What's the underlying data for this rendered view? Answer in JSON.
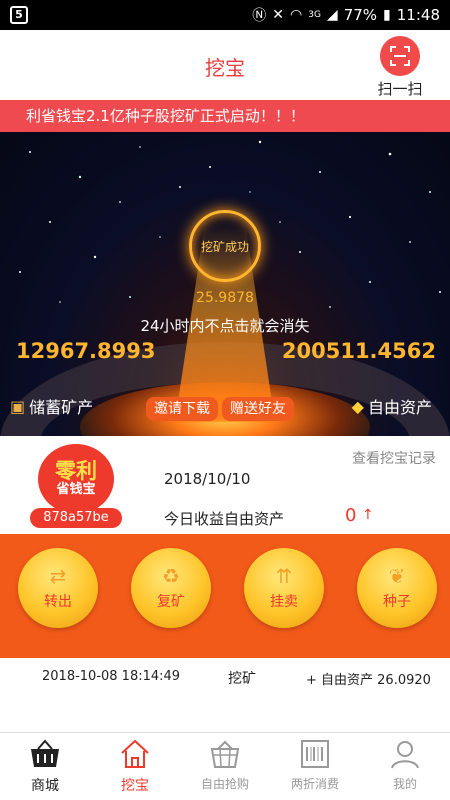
{
  "status_bar": {
    "app_badge": "5",
    "network": "3G",
    "battery": "77%",
    "time": "11:48"
  },
  "header": {
    "title": "挖宝",
    "scan_label": "扫一扫"
  },
  "marquee": {
    "text": "利省钱宝2.1亿种子股挖矿正式启动！！！"
  },
  "hero": {
    "status": "挖矿成功",
    "mined_amount": "25.9878",
    "notice": "24小时内不点击就会消失",
    "stored_amount": "12967.8993",
    "free_amount": "200511.4562",
    "stored_label": "储蓄矿产",
    "free_label": "自由资产",
    "invite_button": "邀请下载",
    "gift_button": "赠送好友"
  },
  "info": {
    "logo_line1": "零利",
    "logo_line2": "省钱宝",
    "user_id": "878a57be",
    "date": "2018/10/10",
    "today_label": "今日收益自由资产",
    "today_count": "0",
    "today_arrow": "↑",
    "record_link": "查看挖宝记录"
  },
  "actions": [
    {
      "label": "转出",
      "icon": "transfer-icon"
    },
    {
      "label": "复矿",
      "icon": "remine-icon"
    },
    {
      "label": "挂卖",
      "icon": "sell-icon"
    },
    {
      "label": "种子",
      "icon": "seed-icon"
    }
  ],
  "record": {
    "time": "2018-10-08 18:14:49",
    "type": "挖矿",
    "amount": "+ 自由资产 26.0920"
  },
  "tabs": [
    {
      "label": "商城",
      "icon": "basket-icon",
      "state": "default"
    },
    {
      "label": "挖宝",
      "icon": "home-icon",
      "state": "active"
    },
    {
      "label": "自由抢购",
      "icon": "cart-icon",
      "state": "inactive"
    },
    {
      "label": "两折消费",
      "icon": "barcode-icon",
      "state": "inactive"
    },
    {
      "label": "我的",
      "icon": "user-icon",
      "state": "inactive"
    }
  ],
  "colors": {
    "accent": "#ee3a2c",
    "band": "#f25a1a",
    "gold": "#ffb52e",
    "marquee": "#ef4a4f"
  }
}
